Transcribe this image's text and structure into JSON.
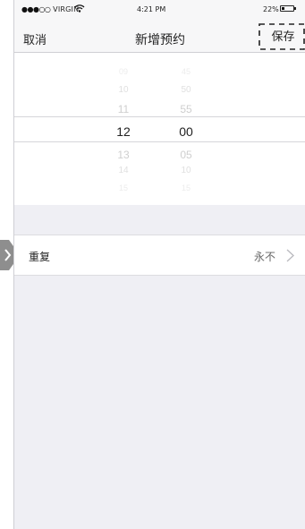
{
  "status_bar": {
    "signal_dots": "●●●○○",
    "carrier": "VIRGIN",
    "time": "4:21 PM",
    "battery_percent": "22%",
    "battery_level": 0.22
  },
  "nav": {
    "cancel_label": "取消",
    "title": "新增预约",
    "save_label": "保存"
  },
  "picker": {
    "hours": [
      "09",
      "10",
      "11",
      "12",
      "13",
      "14",
      "15"
    ],
    "minutes": [
      "45",
      "50",
      "55",
      "00",
      "05",
      "10",
      "15"
    ],
    "selected_hour": "12",
    "selected_minute": "00"
  },
  "repeat": {
    "label": "重复",
    "value": "永不"
  }
}
